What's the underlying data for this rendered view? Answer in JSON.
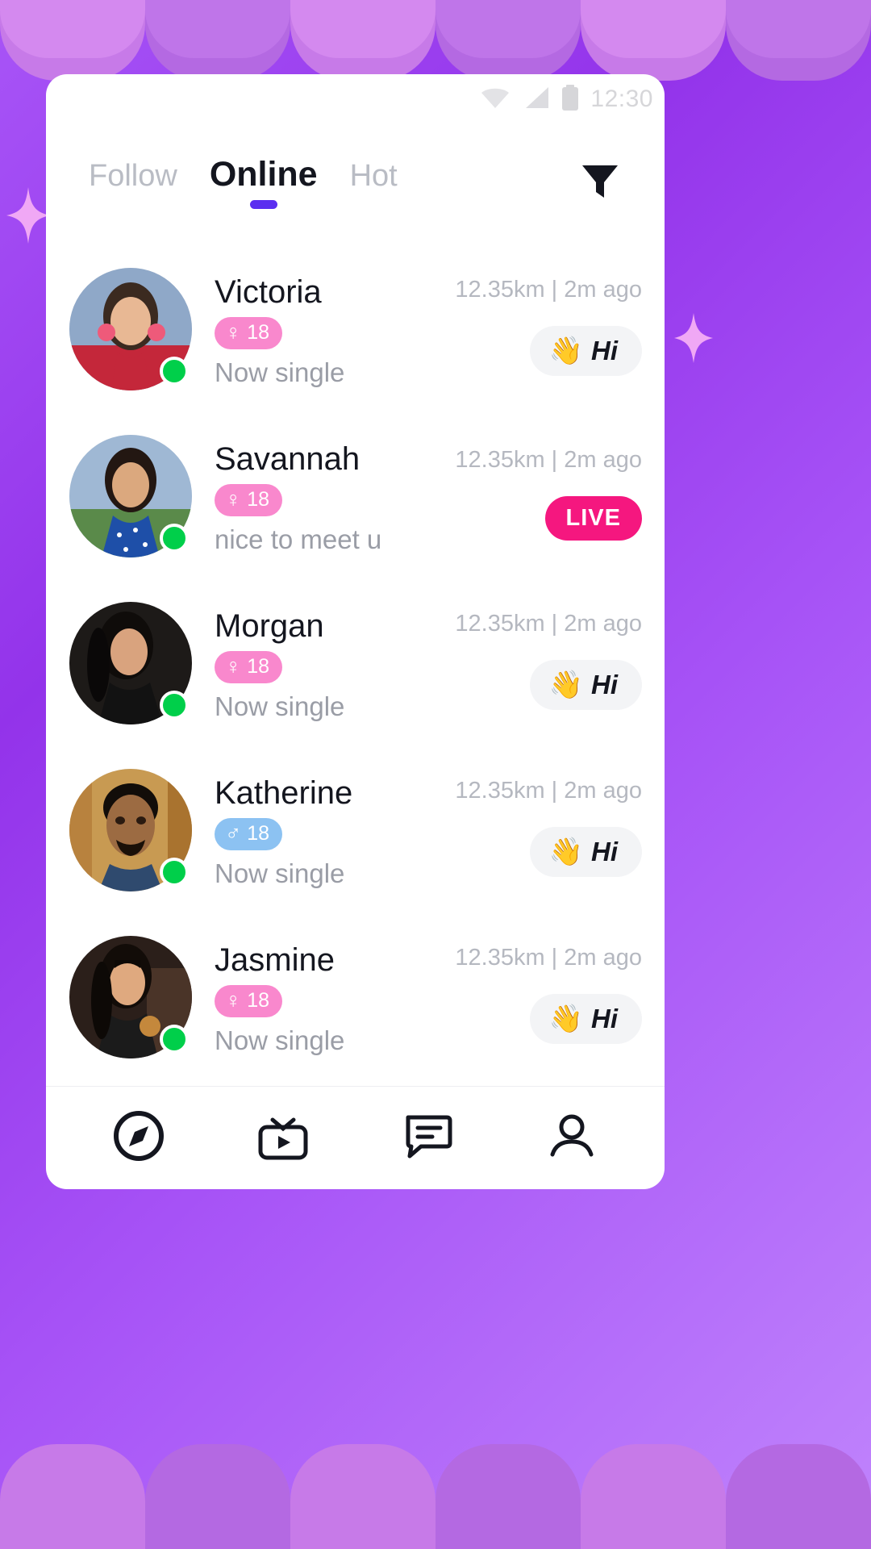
{
  "background": {
    "gradient_from": "#a855f7",
    "gradient_to": "#c084fc",
    "arch_color": "#c77ae8",
    "sparkle_color": "#f0a8f5"
  },
  "statusbar": {
    "time": "12:30",
    "wifi_icon": "wifi-icon",
    "signal_icon": "signal-icon",
    "battery_icon": "battery-icon"
  },
  "tabs": {
    "items": [
      {
        "label": "Follow",
        "active": false
      },
      {
        "label": "Online",
        "active": true
      },
      {
        "label": "Hot",
        "active": false
      }
    ],
    "active_underline_color": "#5b2ef0",
    "filter_icon": "filter-funnel-icon"
  },
  "users": [
    {
      "name": "Victoria",
      "gender": "female",
      "gender_symbol": "♀",
      "age": "18",
      "status": "Now single",
      "distance_time": "12.35km | 2m ago",
      "action": "hi",
      "action_label": "Hi",
      "action_emoji": "👋",
      "online": true
    },
    {
      "name": "Savannah",
      "gender": "female",
      "gender_symbol": "♀",
      "age": "18",
      "status": "nice to meet u",
      "distance_time": "12.35km | 2m ago",
      "action": "live",
      "action_label": "LIVE",
      "action_emoji": "",
      "online": true
    },
    {
      "name": "Morgan",
      "gender": "female",
      "gender_symbol": "♀",
      "age": "18",
      "status": "Now single",
      "distance_time": "12.35km | 2m ago",
      "action": "hi",
      "action_label": "Hi",
      "action_emoji": "👋",
      "online": true
    },
    {
      "name": "Katherine",
      "gender": "male",
      "gender_symbol": "♂",
      "age": "18",
      "status": "Now single",
      "distance_time": "12.35km | 2m ago",
      "action": "hi",
      "action_label": "Hi",
      "action_emoji": "👋",
      "online": true
    },
    {
      "name": "Jasmine",
      "gender": "female",
      "gender_symbol": "♀",
      "age": "18",
      "status": "Now single",
      "distance_time": "12.35km | 2m ago",
      "action": "hi",
      "action_label": "Hi",
      "action_emoji": "👋",
      "online": true
    }
  ],
  "colors": {
    "female_badge": "#f988cd",
    "male_badge": "#8cc2f2",
    "live_badge": "#f5177f",
    "online_dot": "#00cf4a",
    "hi_button_bg": "#f3f4f6"
  },
  "bottomnav": {
    "items": [
      {
        "icon": "compass-icon",
        "active": true
      },
      {
        "icon": "tv-live-icon",
        "active": false
      },
      {
        "icon": "chat-bubble-icon",
        "active": false
      },
      {
        "icon": "person-profile-icon",
        "active": false
      }
    ]
  }
}
